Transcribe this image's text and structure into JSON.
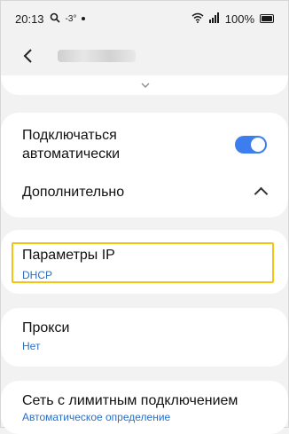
{
  "status": {
    "time": "20:13",
    "temp": "-3°",
    "battery": "100%"
  },
  "auto_connect": {
    "label_line1": "Подключаться",
    "label_line2": "автоматически",
    "enabled": true
  },
  "advanced": {
    "label": "Дополнительно"
  },
  "ip_settings": {
    "title": "Параметры IP",
    "value": "DHCP"
  },
  "proxy": {
    "title": "Прокси",
    "value": "Нет"
  },
  "metered": {
    "title": "Сеть с лимитным подключением",
    "value": "Автоматическое определение"
  },
  "colors": {
    "accent": "#3d7ded",
    "highlight": "#f3c316",
    "link": "#2b6fc2"
  }
}
